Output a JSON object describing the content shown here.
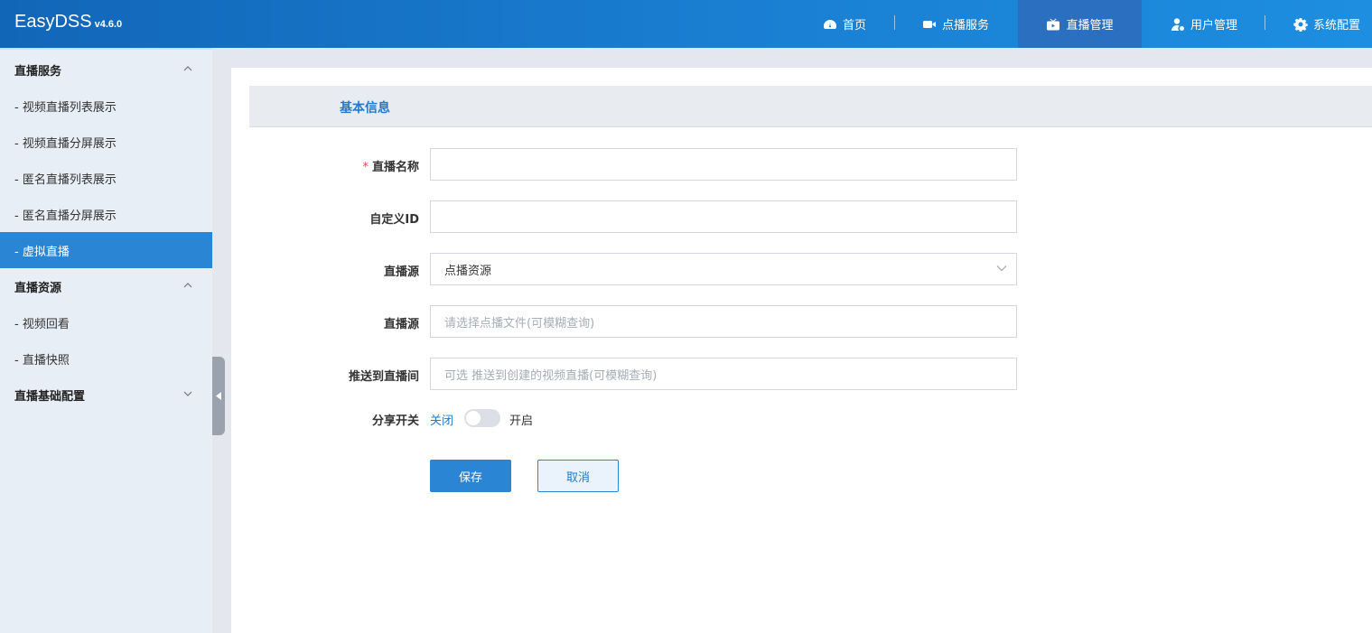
{
  "header": {
    "brand": "EasyDSS",
    "version": "v4.6.0",
    "nav": [
      {
        "label": "首页",
        "icon": "dashboard-icon"
      },
      {
        "label": "点播服务",
        "icon": "video-camera-icon"
      },
      {
        "label": "直播管理",
        "icon": "live-tv-icon",
        "active": true
      },
      {
        "label": "用户管理",
        "icon": "user-settings-icon"
      },
      {
        "label": "系统配置",
        "icon": "gear-icon"
      }
    ]
  },
  "sidebar": {
    "groups": [
      {
        "label": "直播服务",
        "expanded": true,
        "items": [
          "- 视频直播列表展示",
          "- 视频直播分屏展示",
          "- 匿名直播列表展示",
          "- 匿名直播分屏展示",
          "- 虚拟直播"
        ]
      },
      {
        "label": "直播资源",
        "expanded": true,
        "items": [
          "- 视频回看",
          "- 直播快照"
        ]
      },
      {
        "label": "直播基础配置",
        "expanded": false,
        "items": []
      }
    ],
    "active_item": "- 虚拟直播"
  },
  "form": {
    "section_title": "基本信息",
    "required_mark": "*",
    "fields": [
      {
        "label": "直播名称",
        "value": "",
        "placeholder": ""
      },
      {
        "label": "自定义ID",
        "value": "",
        "placeholder": ""
      },
      {
        "label": "直播源",
        "value": "点播资源",
        "type": "select"
      },
      {
        "label": "直播源",
        "value": "",
        "placeholder": "请选择点播文件(可模糊查询)"
      },
      {
        "label": "推送到直播间",
        "value": "",
        "placeholder": "可选 推送到创建的视频直播(可模糊查询)"
      }
    ],
    "share": {
      "label": "分享开关",
      "off_label": "关闭",
      "on_label": "开启",
      "enabled": false
    },
    "buttons": {
      "save": "保存",
      "cancel": "取消"
    }
  },
  "colors": {
    "accent": "#2a85d4",
    "header_start": "#1266b8",
    "header_end": "#1d8ee0",
    "required": "#e0463c"
  }
}
